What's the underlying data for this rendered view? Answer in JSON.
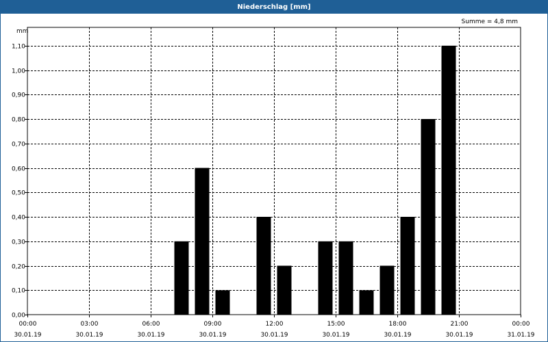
{
  "window": {
    "title": "Niederschlag [mm]"
  },
  "chart_data": {
    "type": "bar",
    "title": "Niederschlag [mm]",
    "annotation": "Summe = 4,8 mm",
    "ylabel": "mm",
    "ylim": [
      0,
      1.175
    ],
    "grid": true,
    "y_ticks": [
      "0,00",
      "0,10",
      "0,20",
      "0,30",
      "0,40",
      "0,50",
      "0,60",
      "0,70",
      "0,80",
      "0,90",
      "1,00",
      "1,10"
    ],
    "y_tick_values": [
      0,
      0.1,
      0.2,
      0.3,
      0.4,
      0.5,
      0.6,
      0.7,
      0.8,
      0.9,
      1.0,
      1.1
    ],
    "x_ticks": [
      {
        "time": "00:00",
        "date": "30.01.19"
      },
      {
        "time": "03:00",
        "date": "30.01.19"
      },
      {
        "time": "06:00",
        "date": "30.01.19"
      },
      {
        "time": "09:00",
        "date": "30.01.19"
      },
      {
        "time": "12:00",
        "date": "30.01.19"
      },
      {
        "time": "15:00",
        "date": "30.01.19"
      },
      {
        "time": "18:00",
        "date": "30.01.19"
      },
      {
        "time": "21:00",
        "date": "30.01.19"
      },
      {
        "time": "00:00",
        "date": "31.01.19"
      }
    ],
    "xlim_hours": [
      0,
      24
    ],
    "x_tick_hours": [
      0,
      3,
      6,
      9,
      12,
      15,
      18,
      21,
      24
    ],
    "bars": [
      {
        "hour": 7.5,
        "value": 0.3
      },
      {
        "hour": 8.5,
        "value": 0.6
      },
      {
        "hour": 9.5,
        "value": 0.1
      },
      {
        "hour": 11.5,
        "value": 0.4
      },
      {
        "hour": 12.5,
        "value": 0.2
      },
      {
        "hour": 14.5,
        "value": 0.3
      },
      {
        "hour": 15.5,
        "value": 0.3
      },
      {
        "hour": 16.5,
        "value": 0.1
      },
      {
        "hour": 17.5,
        "value": 0.2
      },
      {
        "hour": 18.5,
        "value": 0.4
      },
      {
        "hour": 19.5,
        "value": 0.8
      },
      {
        "hour": 20.5,
        "value": 1.1
      }
    ],
    "bar_color": "#000000"
  }
}
